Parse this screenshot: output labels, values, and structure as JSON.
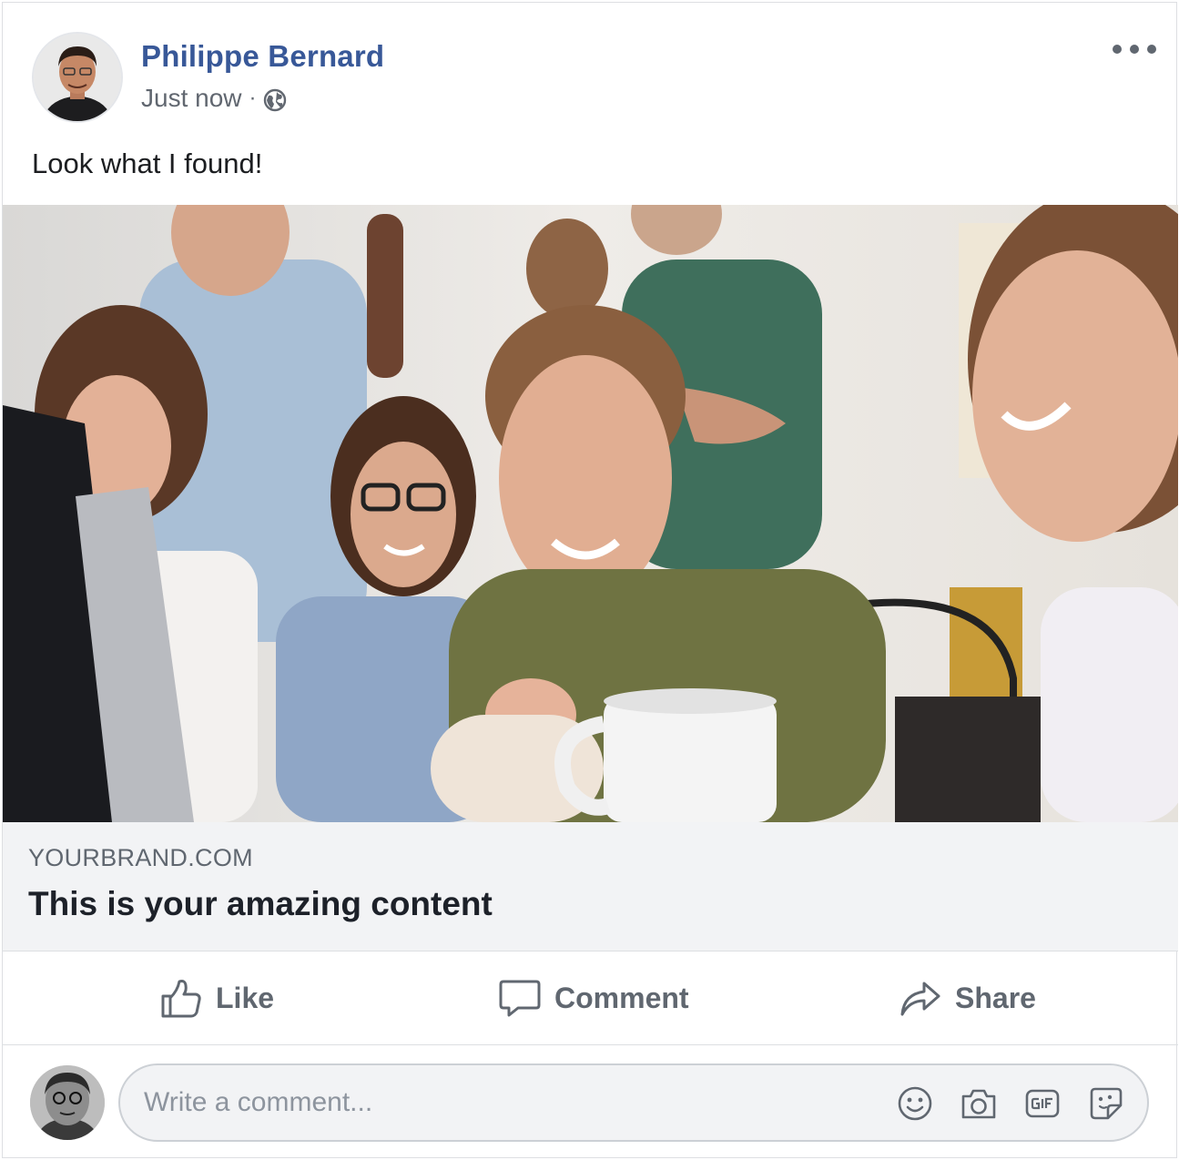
{
  "post": {
    "author": "Philippe Bernard",
    "timestamp": "Just now",
    "separator": "·",
    "privacy_icon": "globe-icon",
    "text": "Look what I found!",
    "more_icon": "more-options-icon"
  },
  "link_preview": {
    "domain": "YOURBRAND.COM",
    "title": "This is your amazing content"
  },
  "actions": {
    "like": "Like",
    "comment": "Comment",
    "share": "Share"
  },
  "comment_box": {
    "placeholder": "Write a comment...",
    "icons": [
      "emoji-icon",
      "camera-icon",
      "gif-icon",
      "sticker-icon"
    ]
  },
  "colors": {
    "name": "#385898",
    "meta": "#616770",
    "action": "#606770",
    "link_bg": "#f2f3f5",
    "border": "#dddfe2"
  }
}
